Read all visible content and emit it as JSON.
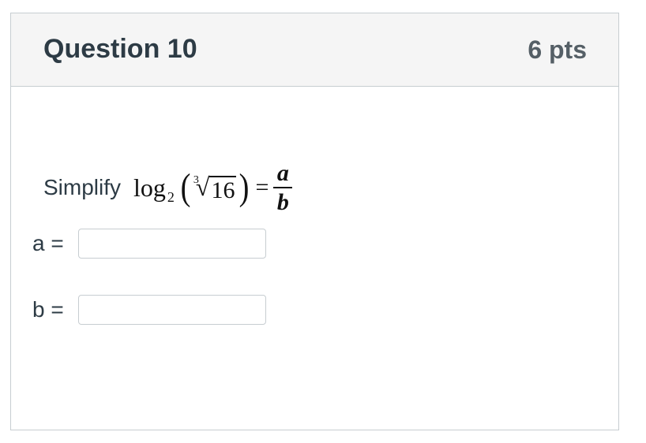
{
  "question": {
    "title": "Question 10",
    "points": "6 pts",
    "prompt": "Simplify",
    "math": {
      "log": "log",
      "base": "2",
      "root_index": "3",
      "radical": "√",
      "radicand": "16",
      "open_paren": "(",
      "close_paren": ")",
      "equals": "=",
      "numerator": "a",
      "denominator": "b"
    }
  },
  "answers": [
    {
      "label": "a =",
      "value": ""
    },
    {
      "label": "b =",
      "value": ""
    }
  ]
}
